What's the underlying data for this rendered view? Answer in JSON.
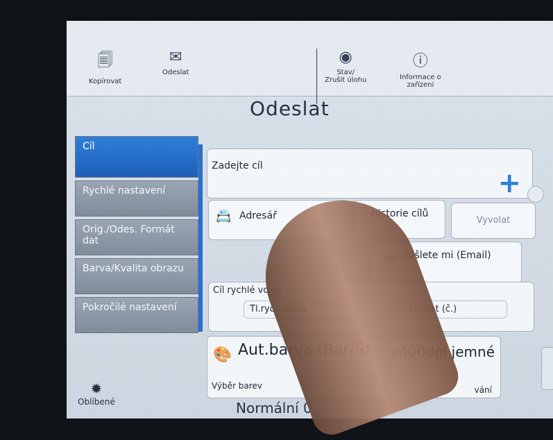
{
  "topbar": {
    "copy_label": "Kopírovat",
    "send_label": "Odeslat",
    "status_label_line1": "Stav/",
    "status_label_line2": "Zrušit úlohu",
    "info_label_line1": "Informace o",
    "info_label_line2": "zařízení"
  },
  "page": {
    "title": "Odeslat"
  },
  "sidebar": {
    "items": [
      {
        "label": "Cíl"
      },
      {
        "label": "Rychlé nastavení"
      },
      {
        "label": "Orig./Odes. Formát dat"
      },
      {
        "label": "Barva/Kvalita obrazu"
      },
      {
        "label": "Pokročilé nastavení"
      }
    ]
  },
  "destination": {
    "label": "Zadejte cíl",
    "plus": "+"
  },
  "buttons": {
    "address_book": "Adresář",
    "history": "Historie cílů",
    "recall": "Vyvolat",
    "send_me": "Pošlete mi (Email)"
  },
  "speed_dial": {
    "header": "Cíl rychlé volby",
    "field1": "Tl.rych.volby",
    "field2": "Hledat (č.)"
  },
  "color": {
    "value": "Aut.barva (Bar/Š)",
    "caption": "Výběr barev"
  },
  "resolution": {
    "value": "x400dpi jemné",
    "caption": "vání"
  },
  "favorites": {
    "label": "Oblíbené"
  },
  "footer": {
    "normal": "Normální 0"
  },
  "colors": {
    "accent": "#2f7fd8",
    "title": "#253045"
  }
}
